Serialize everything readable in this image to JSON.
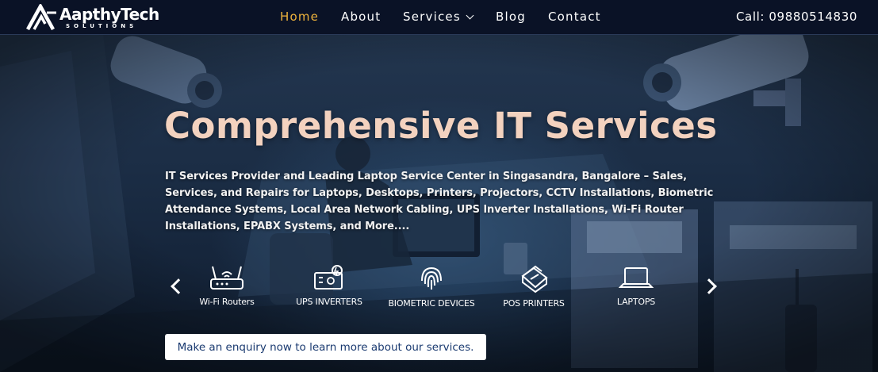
{
  "brand": {
    "name": "AapthyTech",
    "tagline": "SOLUTIONS"
  },
  "nav": {
    "items": [
      {
        "label": "Home",
        "active": true
      },
      {
        "label": "About",
        "active": false
      },
      {
        "label": "Services",
        "active": false,
        "has_dropdown": true
      },
      {
        "label": "Blog",
        "active": false
      },
      {
        "label": "Contact",
        "active": false
      }
    ],
    "call": "Call: 09880514830"
  },
  "hero": {
    "title": "Comprehensive IT Services",
    "description": "IT Services Provider and Leading Laptop Service Center in Singasandra, Bangalore – Sales, Services, and Repairs for Laptops, Desktops, Printers, Projectors, CCTV Installations, Biometric Attendance Systems, Local Area Network Cabling, UPS Inverter Installations, Wi-Fi Router Installations, EPABX Systems, and More....",
    "services": [
      {
        "label": "Wi-Fi Routers",
        "icon": "wifi-router-icon"
      },
      {
        "label": "UPS INVERTERS",
        "icon": "ups-inverter-icon"
      },
      {
        "label": "BIOMETRIC DEVICES",
        "icon": "fingerprint-icon"
      },
      {
        "label": "POS PRINTERS",
        "icon": "pos-printer-icon"
      },
      {
        "label": "LAPTOPS",
        "icon": "laptop-icon"
      }
    ],
    "cta": "Make an enquiry now to learn more about our services."
  },
  "colors": {
    "header_bg": "#0a1226",
    "nav_active": "#f0b43c",
    "title": "#f3d2bf",
    "cta_text": "#1a3a70"
  }
}
